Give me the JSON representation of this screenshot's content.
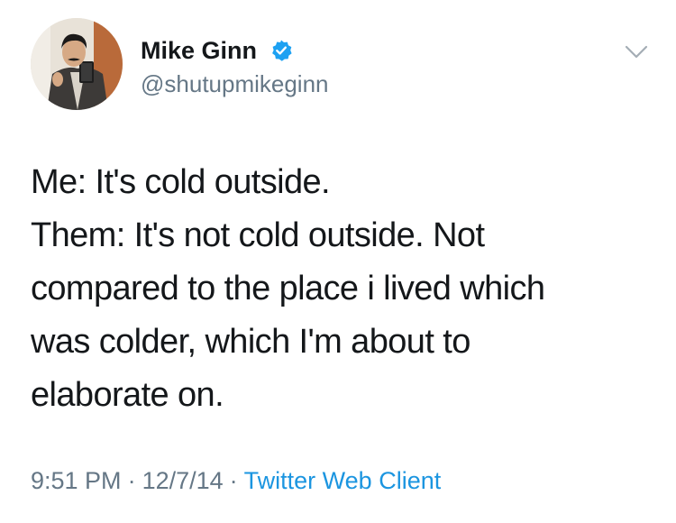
{
  "user": {
    "display_name": "Mike Ginn",
    "handle": "@shutupmikeginn",
    "verified": true,
    "avatar_icon": "profile-photo"
  },
  "tweet": {
    "lines": [
      "Me: It's cold outside.",
      "Them: It's not cold outside. Not",
      "compared to the place i lived which",
      "was colder, which I'm about to",
      "elaborate on."
    ],
    "time": "9:51 PM",
    "separator": "·",
    "date": "12/7/14",
    "client": "Twitter Web Client"
  },
  "menu": {
    "icon": "chevron-down-icon"
  },
  "colors": {
    "text": "#14171a",
    "secondary": "#657786",
    "link": "#1b95e0",
    "verified": "#1da1f2"
  }
}
